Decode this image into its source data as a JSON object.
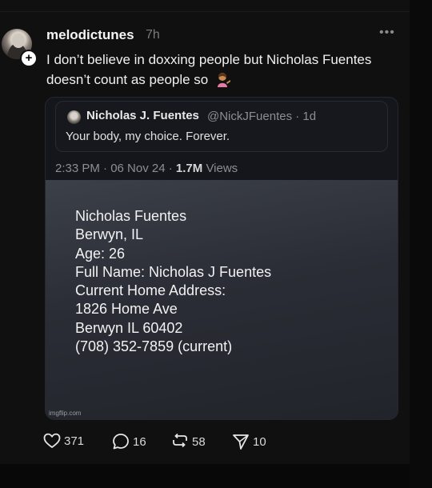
{
  "post": {
    "username": "melodictunes",
    "time": "7h",
    "text": "I don’t believe in doxxing people but Nicholas Fuentes doesn’t count as people so",
    "more_icon": "more-horizontal-icon"
  },
  "quote": {
    "name": "Nicholas J. Fuentes",
    "handle": "@NickJFuentes · 1d",
    "body": "Your body, my choice. Forever.",
    "time": "2:33 PM · 06 Nov 24 ·",
    "views_count": "1.7M",
    "views_label": "Views"
  },
  "image": {
    "lines": [
      "Nicholas Fuentes",
      "Berwyn, IL",
      "Age: 26",
      "Full Name: Nicholas J Fuentes",
      "Current Home Address:",
      "1826 Home Ave",
      "Berwyn IL 60402",
      "(708) 352-7859 (current)"
    ],
    "watermark": "imgflip.com"
  },
  "actions": {
    "likes": "371",
    "replies": "16",
    "reposts": "58",
    "shares": "10"
  },
  "colors": {
    "background": "#101010",
    "muted": "#7a7a7a"
  }
}
